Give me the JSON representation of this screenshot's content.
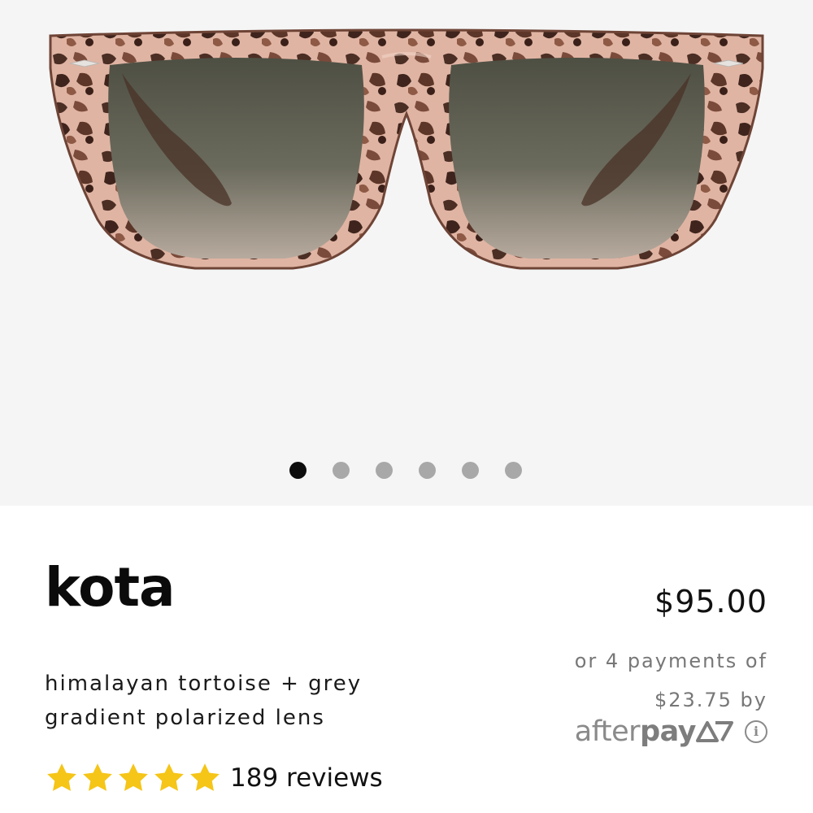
{
  "product": {
    "name": "kota",
    "description": "himalayan tortoise + grey gradient polarized lens",
    "price": "$95.00",
    "rating_stars": 5,
    "reviews_label": "189 reviews",
    "image_alt": "kota sunglasses front view"
  },
  "carousel": {
    "total_dots": 6,
    "active_index": 0
  },
  "afterpay": {
    "text": "or 4 payments of $23.75 by",
    "logo_light": "after",
    "logo_bold": "pay",
    "info_symbol": "i"
  },
  "colors": {
    "star": "#f5c518",
    "hero_bg": "#f5f5f5",
    "frame_tortoise": "#a8766a",
    "lens": "#595a4b"
  }
}
